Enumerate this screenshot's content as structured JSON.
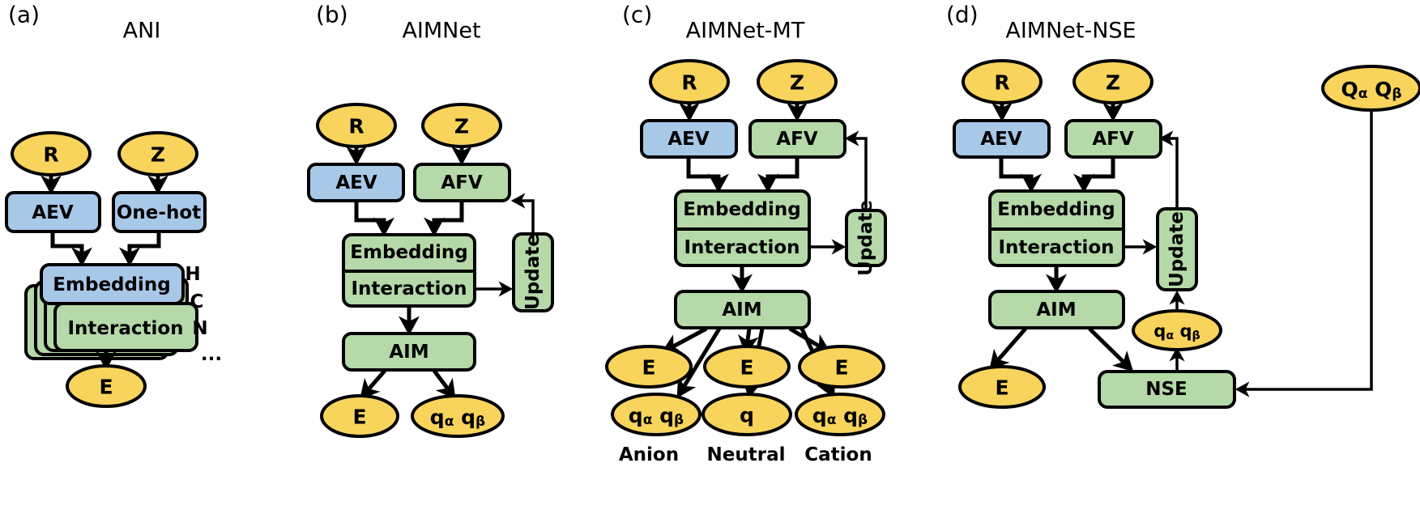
{
  "figure": {
    "background": "#ffffff",
    "colors": {
      "blue": "#a8c8e8",
      "green": "#b5d9a8",
      "yellow": "#f8d45c",
      "outline": "#000000"
    }
  },
  "panels": [
    {
      "id": "a",
      "tag": "(a)",
      "title": "ANI",
      "inputs": [
        {
          "label": "R"
        },
        {
          "label": "Z"
        }
      ],
      "featurizers": [
        {
          "label": "AEV",
          "color": "blue"
        },
        {
          "label": "One-hot",
          "color": "blue"
        }
      ],
      "blocks": [
        {
          "label": "Embedding",
          "color": "blue"
        },
        {
          "label": "Interaction",
          "color": "green"
        }
      ],
      "stack_labels": [
        "H",
        "C",
        "N",
        "..."
      ],
      "outputs": [
        {
          "label": "E"
        }
      ]
    },
    {
      "id": "b",
      "tag": "(b)",
      "title": "AIMNet",
      "inputs": [
        {
          "label": "R"
        },
        {
          "label": "Z"
        }
      ],
      "featurizers": [
        {
          "label": "AEV",
          "color": "blue"
        },
        {
          "label": "AFV",
          "color": "green"
        }
      ],
      "blocks": [
        {
          "label": "Embedding",
          "color": "green"
        },
        {
          "label": "Interaction",
          "color": "green"
        }
      ],
      "update_label": "Update",
      "aim_label": "AIM",
      "outputs": [
        {
          "label": "E"
        },
        {
          "label": "q",
          "sub1": "α",
          "label2": "q",
          "sub2": "β"
        }
      ]
    },
    {
      "id": "c",
      "tag": "(c)",
      "title": "AIMNet-MT",
      "inputs": [
        {
          "label": "R"
        },
        {
          "label": "Z"
        }
      ],
      "featurizers": [
        {
          "label": "AEV",
          "color": "blue"
        },
        {
          "label": "AFV",
          "color": "green"
        }
      ],
      "blocks": [
        {
          "label": "Embedding",
          "color": "green"
        },
        {
          "label": "Interaction",
          "color": "green"
        }
      ],
      "update_label": "Update",
      "aim_label": "AIM",
      "branches": [
        {
          "energy": "E",
          "charge_prefix": "q",
          "charge_sub1": "α",
          "charge_prefix2": "q",
          "charge_sub2": "β",
          "caption": "Anion"
        },
        {
          "energy": "E",
          "charge_prefix": "q",
          "charge_sub1": "",
          "charge_prefix2": "",
          "charge_sub2": "",
          "caption": "Neutral"
        },
        {
          "energy": "E",
          "charge_prefix": "q",
          "charge_sub1": "α",
          "charge_prefix2": "q",
          "charge_sub2": "β",
          "caption": "Cation"
        }
      ]
    },
    {
      "id": "d",
      "tag": "(d)",
      "title": "AIMNet-NSE",
      "inputs": [
        {
          "label": "R"
        },
        {
          "label": "Z"
        },
        {
          "label": "Q",
          "sub1": "α",
          "label2": "Q",
          "sub2": "β"
        }
      ],
      "featurizers": [
        {
          "label": "AEV",
          "color": "blue"
        },
        {
          "label": "AFV",
          "color": "green"
        }
      ],
      "blocks": [
        {
          "label": "Embedding",
          "color": "green"
        },
        {
          "label": "Interaction",
          "color": "green"
        }
      ],
      "update_label": "Update",
      "aim_label": "AIM",
      "nse_label": "NSE",
      "outputs": [
        {
          "label": "E"
        },
        {
          "label": "q",
          "sub1": "α",
          "label2": "q",
          "sub2": "β"
        }
      ]
    }
  ]
}
